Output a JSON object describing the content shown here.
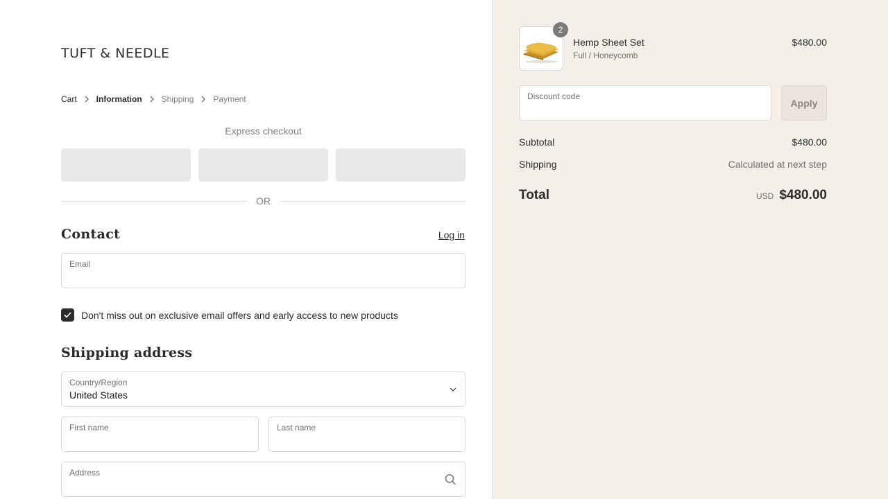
{
  "brand": {
    "logo_text": "TUFT & NEEDLE"
  },
  "breadcrumb": {
    "items": [
      {
        "label": "Cart",
        "state": "link"
      },
      {
        "label": "Information",
        "state": "current"
      },
      {
        "label": "Shipping",
        "state": "upcoming"
      },
      {
        "label": "Payment",
        "state": "upcoming"
      }
    ]
  },
  "express": {
    "title": "Express checkout"
  },
  "divider": {
    "or_text": "OR"
  },
  "contact": {
    "title": "Contact",
    "login_label": "Log in",
    "email_label": "Email",
    "email_value": "",
    "marketing_opt_in_label": "Don't miss out on exclusive email offers and early access to new products",
    "marketing_opt_in_checked": true
  },
  "shipping": {
    "title": "Shipping address",
    "country_label": "Country/Region",
    "country_value": "United States",
    "first_name_label": "First name",
    "last_name_label": "Last name",
    "address_label": "Address"
  },
  "order": {
    "item": {
      "name": "Hemp Sheet Set",
      "variant": "Full / Honeycomb",
      "price": "$480.00",
      "quantity": "2"
    },
    "discount_label": "Discount code",
    "apply_label": "Apply",
    "subtotal_label": "Subtotal",
    "subtotal_value": "$480.00",
    "shipping_label": "Shipping",
    "shipping_value": "Calculated at next step",
    "total_label": "Total",
    "currency": "USD",
    "total_value": "$480.00"
  },
  "colors": {
    "summary_background": "#f4efe9",
    "express_button": "#e8e8e6",
    "checkbox": "#2b2b2b",
    "product_gold": "#d9a531"
  }
}
